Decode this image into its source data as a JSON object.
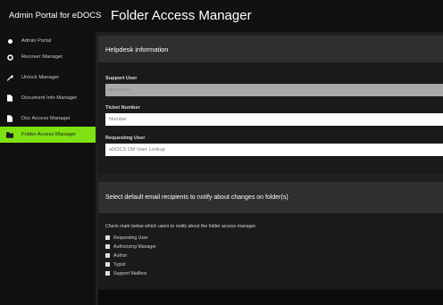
{
  "header": {
    "brand": "Admin Portal for eDOCS",
    "title": "Folder Access Manager"
  },
  "sidebar": {
    "items": [
      {
        "label": "Admin Portal",
        "icon": "home-icon",
        "active": false
      },
      {
        "label": "Recover Manager",
        "icon": "gear-icon",
        "active": false
      },
      {
        "label": "Unlock Manager",
        "icon": "key-icon",
        "active": false
      },
      {
        "label": "Document Info Manager",
        "icon": "document-icon",
        "active": false
      },
      {
        "label": "Doc Access Manager",
        "icon": "document-icon",
        "active": false
      },
      {
        "label": "Folder Access Manager",
        "icon": "folder-icon",
        "active": true
      }
    ]
  },
  "helpdesk": {
    "section_title": "Helpdesk information",
    "support_user_label": "Support User",
    "support_user_value": "dmadmin",
    "ticket_label": "Ticket Number",
    "ticket_placeholder": "Number",
    "requesting_label": "Requesting User",
    "requesting_placeholder": "eDOCS DM User Lookup"
  },
  "notify": {
    "section_title": "Select default email recipients to notify about changes on folder(s)",
    "instructions": "Check mark below which users to notify about the folder access manager.",
    "options": [
      {
        "label": "Requesting User",
        "checked": true
      },
      {
        "label": "Authorizing Manager",
        "checked": true
      },
      {
        "label": "Author",
        "checked": true
      },
      {
        "label": "Typist",
        "checked": true
      },
      {
        "label": "Support Mailbox",
        "checked": true
      }
    ]
  },
  "colors": {
    "accent": "#7fe013",
    "topbar": "#111111",
    "panel_header": "#2f2f2f"
  }
}
